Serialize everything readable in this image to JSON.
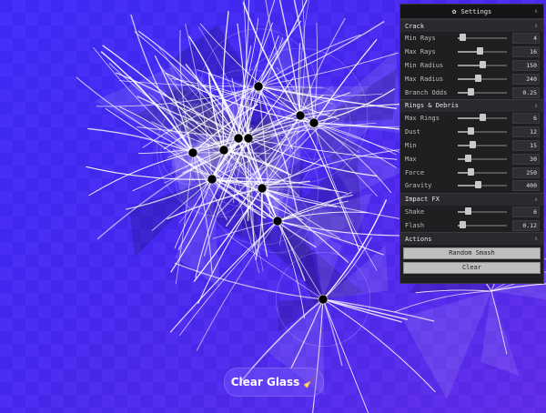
{
  "panel": {
    "title": "Settings",
    "title_icon": "gear-icon",
    "collapse_glyph": "∧",
    "sections": [
      {
        "label": "Crack",
        "controls": [
          {
            "label": "Min Rays",
            "value": "4",
            "level": 0.1
          },
          {
            "label": "Max Rays",
            "value": "16",
            "level": 0.45
          },
          {
            "label": "Min Radius",
            "value": "150",
            "level": 0.5
          },
          {
            "label": "Max Radius",
            "value": "240",
            "level": 0.4
          },
          {
            "label": "Branch Odds",
            "value": "0.25",
            "level": 0.25
          }
        ]
      },
      {
        "label": "Rings & Debris",
        "controls": [
          {
            "label": "Max Rings",
            "value": "6",
            "level": 0.5
          },
          {
            "label": "Dust",
            "value": "12",
            "level": 0.25
          },
          {
            "label": "Min",
            "value": "15",
            "level": 0.3
          },
          {
            "label": "Max",
            "value": "30",
            "level": 0.2
          },
          {
            "label": "Force",
            "value": "250",
            "level": 0.25
          },
          {
            "label": "Gravity",
            "value": "400",
            "level": 0.4
          }
        ]
      },
      {
        "label": "Impact FX",
        "controls": [
          {
            "label": "Shake",
            "value": "6",
            "level": 0.2
          },
          {
            "label": "Flash",
            "value": "0.12",
            "level": 0.1
          }
        ]
      },
      {
        "label": "Actions",
        "buttons": [
          "Random Smash",
          "Clear"
        ]
      }
    ]
  },
  "bottom_button": {
    "label": "Clear Glass",
    "icon": "broom-icon"
  }
}
